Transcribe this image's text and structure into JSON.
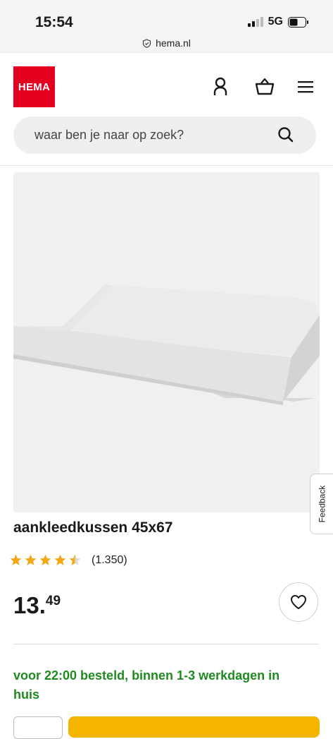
{
  "status": {
    "time": "15:54",
    "network": "5G"
  },
  "browser": {
    "url": "hema.nl"
  },
  "header": {
    "logo_text": "HEMA"
  },
  "search": {
    "placeholder": "waar ben je naar op zoek?"
  },
  "feedback": {
    "label": "Feedback"
  },
  "product": {
    "title": "aankleedkussen 45x67",
    "rating": {
      "value": 4.5,
      "max": 5,
      "count_text": "(1.350)"
    },
    "price": {
      "main": "13.",
      "cents": "49"
    },
    "delivery": "voor 22:00 besteld, binnen 1-3 werkdagen in huis"
  },
  "colors": {
    "brand": "#e4001f",
    "star": "#f3a712",
    "delivery_green": "#1f8a1f",
    "cart_button": "#f5b400"
  }
}
